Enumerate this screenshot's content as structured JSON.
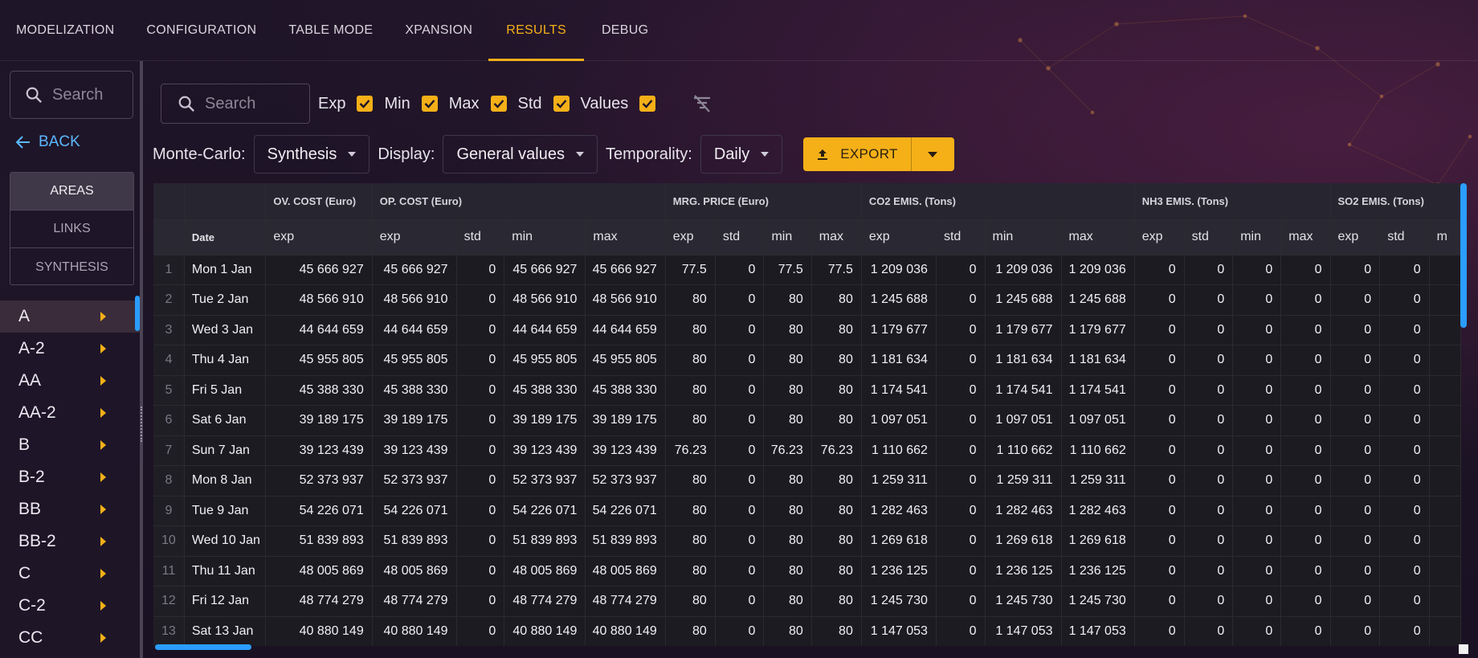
{
  "nav": {
    "tabs": [
      "MODELIZATION",
      "CONFIGURATION",
      "TABLE MODE",
      "XPANSION",
      "RESULTS",
      "DEBUG"
    ],
    "active": "RESULTS"
  },
  "sidebar": {
    "search_placeholder": "Search",
    "back_label": "BACK",
    "segments": [
      "AREAS",
      "LINKS",
      "SYNTHESIS"
    ],
    "active_segment": "AREAS",
    "areas": [
      "A",
      "A-2",
      "AA",
      "AA-2",
      "B",
      "B-2",
      "BB",
      "BB-2",
      "C",
      "C-2",
      "CC"
    ],
    "active_area": "A"
  },
  "filters": {
    "search_placeholder": "Search",
    "checkboxes": [
      {
        "label": "Exp",
        "checked": true
      },
      {
        "label": "Min",
        "checked": true
      },
      {
        "label": "Max",
        "checked": true
      },
      {
        "label": "Std",
        "checked": true
      },
      {
        "label": "Values",
        "checked": true
      }
    ]
  },
  "controls": {
    "montecarlo_label": "Monte-Carlo:",
    "montecarlo_value": "Synthesis",
    "display_label": "Display:",
    "display_value": "General values",
    "temporality_label": "Temporality:",
    "temporality_value": "Daily",
    "export_label": "EXPORT"
  },
  "table": {
    "date_header": "Date",
    "groups": [
      {
        "label": "OV. COST (Euro)",
        "cols": [
          "exp"
        ]
      },
      {
        "label": "OP. COST (Euro)",
        "cols": [
          "exp",
          "std",
          "min",
          "max"
        ]
      },
      {
        "label": "MRG. PRICE (Euro)",
        "cols": [
          "exp",
          "std",
          "min",
          "max"
        ]
      },
      {
        "label": "CO2 EMIS. (Tons)",
        "cols": [
          "exp",
          "std",
          "min",
          "max"
        ]
      },
      {
        "label": "NH3 EMIS. (Tons)",
        "cols": [
          "exp",
          "std",
          "min",
          "max"
        ]
      },
      {
        "label": "SO2 EMIS. (Tons)",
        "cols": [
          "exp",
          "std",
          "m"
        ]
      }
    ],
    "rows": [
      {
        "i": "1",
        "date": "Mon 1 Jan",
        "v": [
          "45 666 927",
          "45 666 927",
          "0",
          "45 666 927",
          "45 666 927",
          "77.5",
          "0",
          "77.5",
          "77.5",
          "1 209 036",
          "0",
          "1 209 036",
          "1 209 036",
          "0",
          "0",
          "0",
          "0",
          "0",
          "0",
          ""
        ]
      },
      {
        "i": "2",
        "date": "Tue 2 Jan",
        "v": [
          "48 566 910",
          "48 566 910",
          "0",
          "48 566 910",
          "48 566 910",
          "80",
          "0",
          "80",
          "80",
          "1 245 688",
          "0",
          "1 245 688",
          "1 245 688",
          "0",
          "0",
          "0",
          "0",
          "0",
          "0",
          ""
        ]
      },
      {
        "i": "3",
        "date": "Wed 3 Jan",
        "v": [
          "44 644 659",
          "44 644 659",
          "0",
          "44 644 659",
          "44 644 659",
          "80",
          "0",
          "80",
          "80",
          "1 179 677",
          "0",
          "1 179 677",
          "1 179 677",
          "0",
          "0",
          "0",
          "0",
          "0",
          "0",
          ""
        ]
      },
      {
        "i": "4",
        "date": "Thu 4 Jan",
        "v": [
          "45 955 805",
          "45 955 805",
          "0",
          "45 955 805",
          "45 955 805",
          "80",
          "0",
          "80",
          "80",
          "1 181 634",
          "0",
          "1 181 634",
          "1 181 634",
          "0",
          "0",
          "0",
          "0",
          "0",
          "0",
          ""
        ]
      },
      {
        "i": "5",
        "date": "Fri 5 Jan",
        "v": [
          "45 388 330",
          "45 388 330",
          "0",
          "45 388 330",
          "45 388 330",
          "80",
          "0",
          "80",
          "80",
          "1 174 541",
          "0",
          "1 174 541",
          "1 174 541",
          "0",
          "0",
          "0",
          "0",
          "0",
          "0",
          ""
        ]
      },
      {
        "i": "6",
        "date": "Sat 6 Jan",
        "v": [
          "39 189 175",
          "39 189 175",
          "0",
          "39 189 175",
          "39 189 175",
          "80",
          "0",
          "80",
          "80",
          "1 097 051",
          "0",
          "1 097 051",
          "1 097 051",
          "0",
          "0",
          "0",
          "0",
          "0",
          "0",
          ""
        ]
      },
      {
        "i": "7",
        "date": "Sun 7 Jan",
        "v": [
          "39 123 439",
          "39 123 439",
          "0",
          "39 123 439",
          "39 123 439",
          "76.23",
          "0",
          "76.23",
          "76.23",
          "1 110 662",
          "0",
          "1 110 662",
          "1 110 662",
          "0",
          "0",
          "0",
          "0",
          "0",
          "0",
          ""
        ]
      },
      {
        "i": "8",
        "date": "Mon 8 Jan",
        "v": [
          "52 373 937",
          "52 373 937",
          "0",
          "52 373 937",
          "52 373 937",
          "80",
          "0",
          "80",
          "80",
          "1 259 311",
          "0",
          "1 259 311",
          "1 259 311",
          "0",
          "0",
          "0",
          "0",
          "0",
          "0",
          ""
        ]
      },
      {
        "i": "9",
        "date": "Tue 9 Jan",
        "v": [
          "54 226 071",
          "54 226 071",
          "0",
          "54 226 071",
          "54 226 071",
          "80",
          "0",
          "80",
          "80",
          "1 282 463",
          "0",
          "1 282 463",
          "1 282 463",
          "0",
          "0",
          "0",
          "0",
          "0",
          "0",
          ""
        ]
      },
      {
        "i": "10",
        "date": "Wed 10 Jan",
        "v": [
          "51 839 893",
          "51 839 893",
          "0",
          "51 839 893",
          "51 839 893",
          "80",
          "0",
          "80",
          "80",
          "1 269 618",
          "0",
          "1 269 618",
          "1 269 618",
          "0",
          "0",
          "0",
          "0",
          "0",
          "0",
          ""
        ]
      },
      {
        "i": "11",
        "date": "Thu 11 Jan",
        "v": [
          "48 005 869",
          "48 005 869",
          "0",
          "48 005 869",
          "48 005 869",
          "80",
          "0",
          "80",
          "80",
          "1 236 125",
          "0",
          "1 236 125",
          "1 236 125",
          "0",
          "0",
          "0",
          "0",
          "0",
          "0",
          ""
        ]
      },
      {
        "i": "12",
        "date": "Fri 12 Jan",
        "v": [
          "48 774 279",
          "48 774 279",
          "0",
          "48 774 279",
          "48 774 279",
          "80",
          "0",
          "80",
          "80",
          "1 245 730",
          "0",
          "1 245 730",
          "1 245 730",
          "0",
          "0",
          "0",
          "0",
          "0",
          "0",
          ""
        ]
      },
      {
        "i": "13",
        "date": "Sat 13 Jan",
        "v": [
          "40 880 149",
          "40 880 149",
          "0",
          "40 880 149",
          "40 880 149",
          "80",
          "0",
          "80",
          "80",
          "1 147 053",
          "0",
          "1 147 053",
          "1 147 053",
          "0",
          "0",
          "0",
          "0",
          "0",
          "0",
          ""
        ]
      }
    ]
  }
}
